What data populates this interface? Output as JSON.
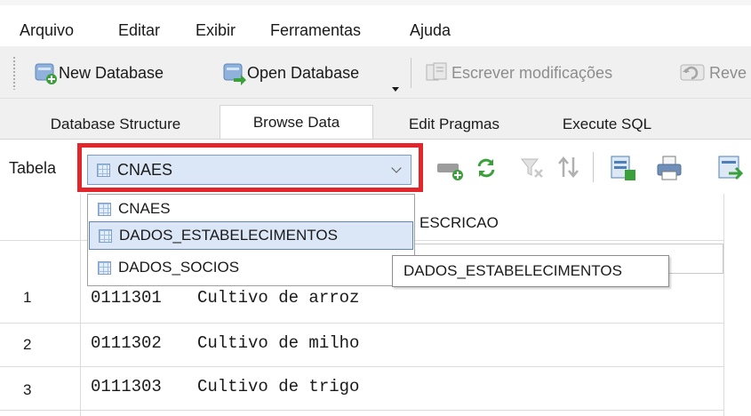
{
  "menu": [
    "Arquivo",
    "Editar",
    "Exibir",
    "Ferramentas",
    "Ajuda"
  ],
  "toolbar": {
    "new_database": "New Database",
    "open_database": "Open Database",
    "write_changes": "Escrever modificações",
    "revert_changes": "Reve"
  },
  "tabs": [
    "Database Structure",
    "Browse Data",
    "Edit Pragmas",
    "Execute SQL"
  ],
  "active_tab": "Browse Data",
  "table_selector": {
    "label": "Tabela",
    "selected": "CNAES",
    "options": [
      "CNAES",
      "DADOS_ESTABELECIMENTOS",
      "DADOS_SOCIOS"
    ],
    "hovered": "DADOS_ESTABELECIMENTOS"
  },
  "tooltip": "DADOS_ESTABELECIMENTOS",
  "grid": {
    "columns": [
      "",
      "DESCRICAO"
    ],
    "column_partial": "ESCRICAO",
    "rows": [
      {
        "num": "1",
        "code": "0111301",
        "desc": "Cultivo de arroz"
      },
      {
        "num": "2",
        "code": "0111302",
        "desc": "Cultivo de milho"
      },
      {
        "num": "3",
        "code": "0111303",
        "desc": "Cultivo de trigo"
      }
    ]
  },
  "colors": {
    "highlight": "#e3262b",
    "selection": "#dbe7f6",
    "selection_border": "#5b86be"
  },
  "icons": [
    "new-database-icon",
    "open-database-icon",
    "write-changes-icon",
    "revert-changes-icon",
    "table-icon",
    "add-record-icon",
    "refresh-icon",
    "clear-filter-icon",
    "sort-icon",
    "print-icon",
    "export-icon"
  ]
}
